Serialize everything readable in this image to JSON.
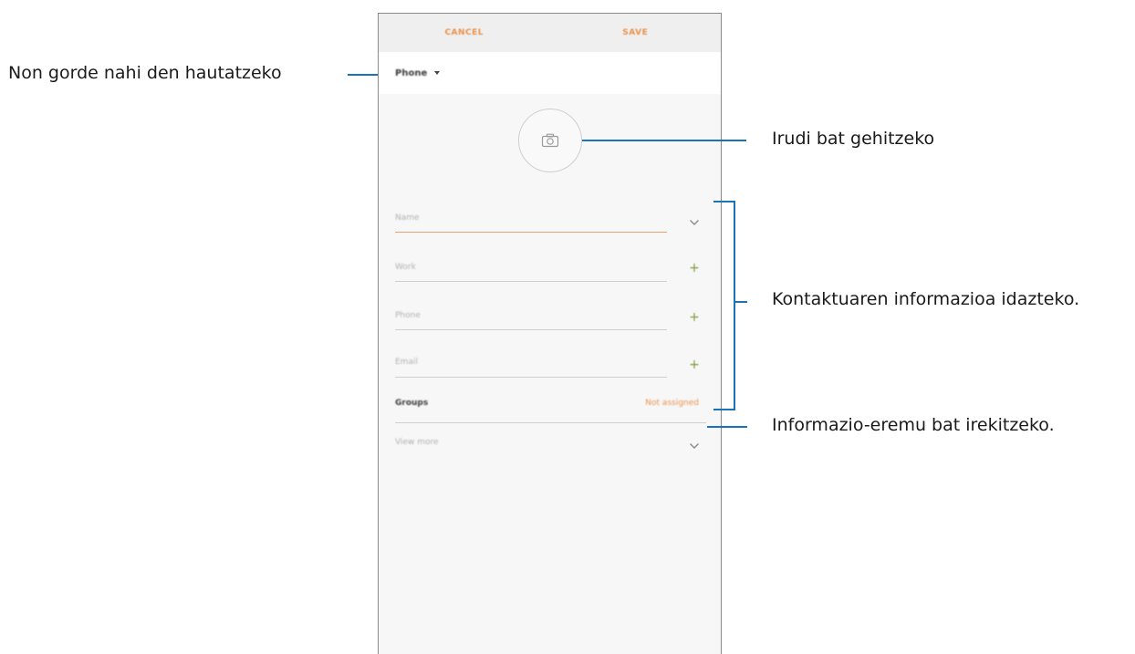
{
  "phone": {
    "topbar": {
      "cancel_label": "CANCEL",
      "save_label": "SAVE"
    },
    "storage": {
      "selected_value": "Phone"
    },
    "form": {
      "name_placeholder": "Name",
      "work_placeholder": "Work",
      "phone_placeholder": "Phone",
      "email_placeholder": "Email",
      "groups_label": "Groups",
      "groups_value": "Not assigned",
      "view_more_label": "View more"
    },
    "colors": {
      "accent": "#e8914c",
      "plus": "#7f9a3a"
    }
  },
  "callouts": {
    "storage": "Non gorde nahi den hautatzeko",
    "image": "Irudi bat gehitzeko",
    "contact_info": "Kontaktuaren informazioa idazteko.",
    "more_fields": "Informazio-eremu bat irekitzeko.",
    "line_color": "#1a73b8"
  }
}
